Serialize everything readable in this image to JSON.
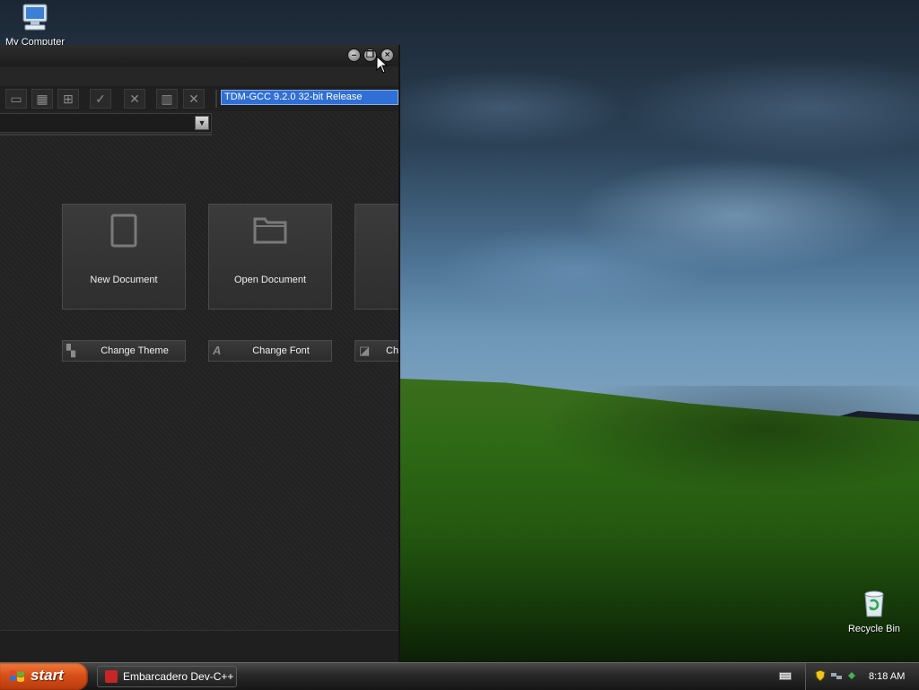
{
  "desktop": {
    "icons": [
      {
        "label": "My Computer",
        "icon": "computer-icon"
      },
      {
        "label": "Recycle Bin",
        "icon": "recycle-bin-icon"
      }
    ]
  },
  "ide": {
    "window_controls": [
      "minimize-icon",
      "restore-icon",
      "close-icon"
    ],
    "toolbar_icons": [
      "window-icon",
      "calendar-grid-icon",
      "tiles-icon",
      "check-icon",
      "cross-icon",
      "chart-icon",
      "close-x-icon"
    ],
    "compiler_selected": "TDM-GCC 9.2.0 32-bit Release",
    "tiles": [
      {
        "label": "New Document",
        "icon": "document-icon"
      },
      {
        "label": "Open Document",
        "icon": "folder-icon"
      }
    ],
    "actions": [
      {
        "label": "Change Theme",
        "icon": "paint-brush-icon"
      },
      {
        "label": "Change Font",
        "icon": "font-icon"
      },
      {
        "label": "Ch",
        "icon": "layout-icon"
      }
    ]
  },
  "taskbar": {
    "start_label": "start",
    "tasks": [
      {
        "label": "Embarcadero Dev-C++",
        "icon": "devcpp-icon"
      }
    ],
    "clock": "8:18 AM"
  },
  "colors": {
    "accent": "#2f6fd6",
    "start": "#d8501a",
    "window_bg": "#232323"
  }
}
